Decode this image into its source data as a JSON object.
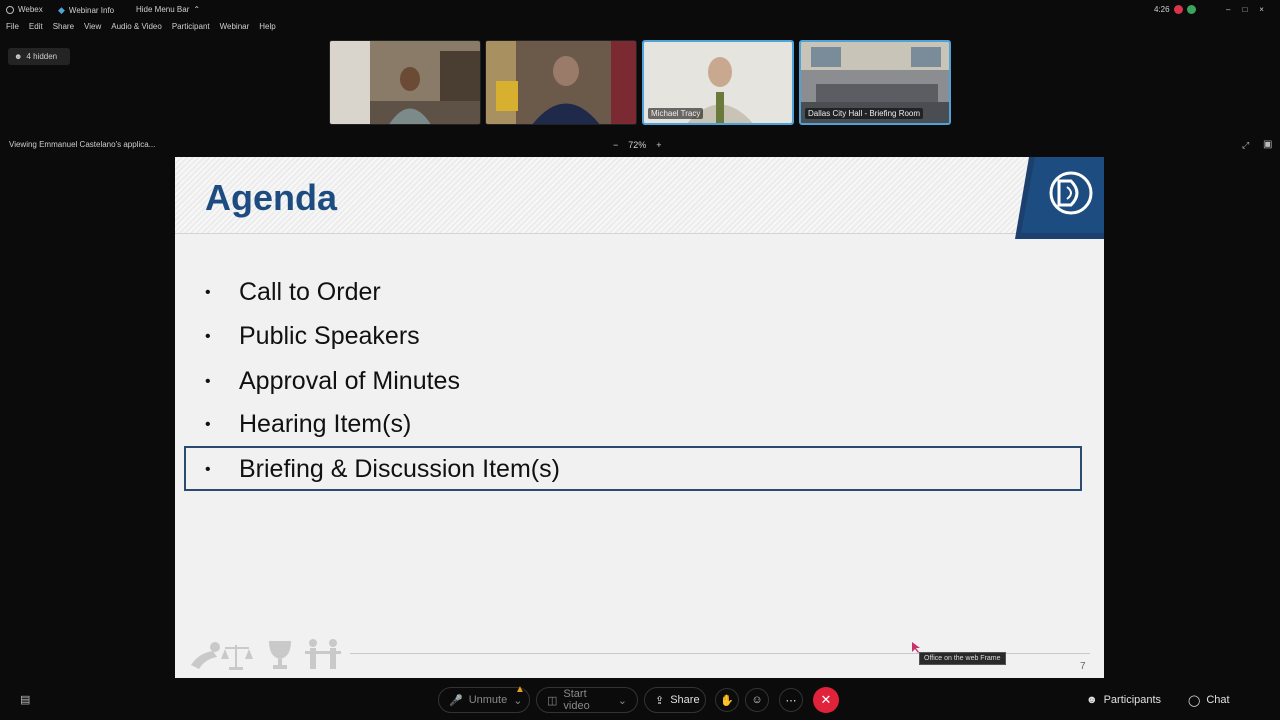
{
  "titlebar": {
    "app_name": "Webex",
    "webinar_info": "Webinar Info",
    "hide_menu_bar": "Hide Menu Bar",
    "time": "4:26"
  },
  "menu": [
    "File",
    "Edit",
    "Share",
    "View",
    "Audio & Video",
    "Participant",
    "Webinar",
    "Help"
  ],
  "hidden_chip": "4 hidden",
  "participants": [
    {
      "name": ""
    },
    {
      "name": ""
    },
    {
      "name": "Michael Tracy"
    },
    {
      "name": "Dallas City Hall - Briefing Room"
    }
  ],
  "viewing_text": "Viewing Emmanuel Castelano's applica...",
  "zoom": {
    "minus": "−",
    "level": "72%",
    "plus": "+"
  },
  "slide": {
    "title": "Agenda",
    "items": [
      "Call to Order",
      "Public Speakers",
      "Approval of Minutes",
      "Hearing Item(s)",
      "Briefing & Discussion Item(s)"
    ],
    "bullet": "•",
    "highlighted_index": 4,
    "page_number": "7"
  },
  "tooltip": "Office on the web Frame",
  "controls": {
    "unmute": "Unmute",
    "start_video": "Start video",
    "share": "Share",
    "participants": "Participants",
    "chat": "Chat"
  },
  "colors": {
    "accent": "#1d4c80",
    "leave": "#e0223b",
    "active_border": "#4fa3d8"
  }
}
